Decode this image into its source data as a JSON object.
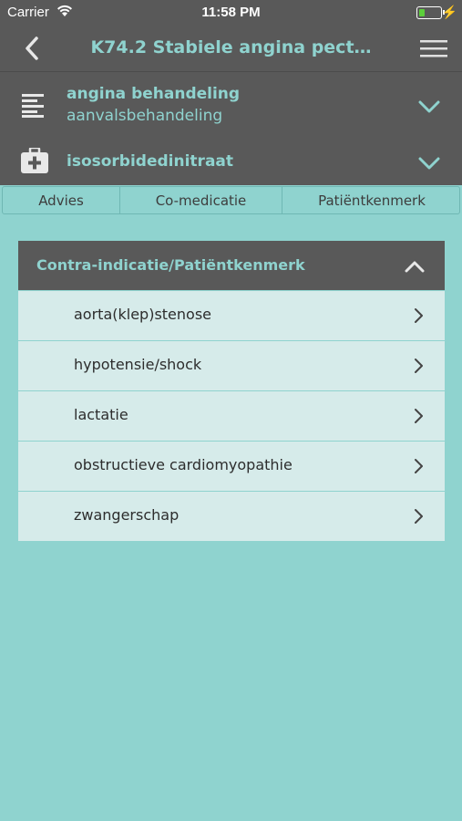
{
  "status_bar": {
    "carrier": "Carrier",
    "time": "11:58 PM",
    "battery_level": 0.25
  },
  "nav": {
    "title": "K74.2 Stabiele angina pect…"
  },
  "selectors": {
    "treatment": {
      "title": "angina behandeling",
      "subtitle": "aanvalsbehandeling"
    },
    "medication": {
      "title": "isosorbidedinitraat"
    }
  },
  "tabs": [
    {
      "label": "Advies"
    },
    {
      "label": "Co-medicatie"
    },
    {
      "label": "Patiëntkenmerk"
    }
  ],
  "card": {
    "header": "Contra-indicatie/Patiëntkenmerk",
    "items": [
      {
        "label": "aorta(klep)stenose"
      },
      {
        "label": "hypotensie/shock"
      },
      {
        "label": "lactatie"
      },
      {
        "label": "obstructieve cardiomyopathie"
      },
      {
        "label": "zwangerschap"
      }
    ]
  },
  "colors": {
    "background": "#8fd3cf",
    "bar": "#595959",
    "accent": "#8fd3cf",
    "row": "#d6ebea"
  }
}
